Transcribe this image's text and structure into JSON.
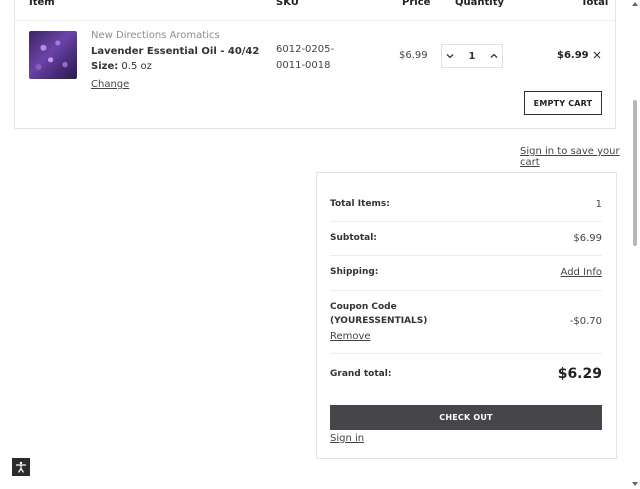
{
  "cart": {
    "headers": {
      "item": "Item",
      "sku": "SKU",
      "price": "Price",
      "quantity": "Quantity",
      "total": "Total"
    },
    "items": [
      {
        "brand": "New Directions Aromatics",
        "name": "Lavender Essential Oil - 40/42",
        "size_label": "Size:",
        "size_value": "0.5 oz",
        "change_label": "Change",
        "sku_line1": "6012-0205-",
        "sku_line2": "0011-0018",
        "price": "$6.99",
        "quantity": "1",
        "total": "$6.99",
        "image_icon": "lavender-product-image"
      }
    ],
    "empty_cart_label": "EMPTY CART",
    "sign_in_save": "Sign in to save your cart"
  },
  "summary": {
    "total_items_label": "Total Items:",
    "total_items_value": "1",
    "subtotal_label": "Subtotal:",
    "subtotal_value": "$6.99",
    "shipping_label": "Shipping:",
    "shipping_action": "Add Info",
    "coupon_label_line1": "Coupon Code",
    "coupon_label_line2": "(YOURESSENTIALS)",
    "coupon_remove": "Remove",
    "coupon_value": "-$0.70",
    "grand_total_label": "Grand total:",
    "grand_total_value": "$6.29",
    "checkout_label": "CHECK OUT",
    "sign_in_label": "Sign in"
  },
  "icons": {
    "decrement": "chevron-down-icon",
    "increment": "chevron-up-icon",
    "remove": "close-icon",
    "accessibility": "accessibility-icon"
  },
  "colors": {
    "checkout_bg": "#46464a",
    "border": "#e5e5e5",
    "text": "#333333"
  }
}
